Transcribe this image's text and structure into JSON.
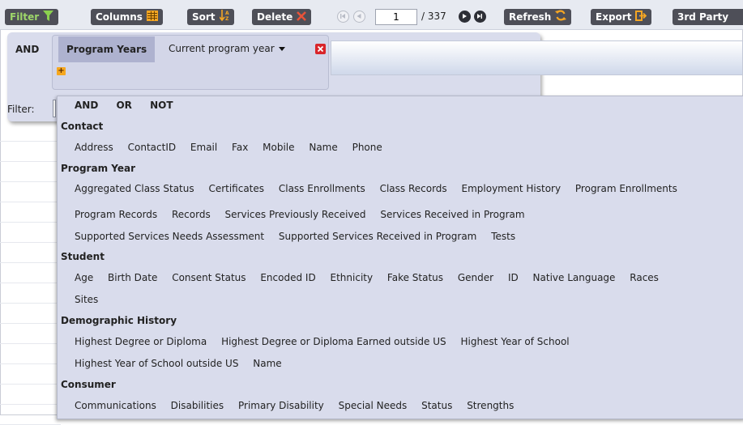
{
  "toolbar": {
    "filter_label": "Filter",
    "columns_label": "Columns",
    "sort_label": "Sort",
    "delete_label": "Delete",
    "page_value": "1",
    "page_total": "/ 337",
    "refresh_label": "Refresh",
    "export_label": "Export",
    "third_party_label": "3rd Party"
  },
  "filter_panel": {
    "root_operator": "AND",
    "condition_field": "Program Years",
    "condition_value": "Current program year",
    "add_symbol": "+",
    "filter_row_label": "Filter:"
  },
  "dropdown": {
    "operators": [
      "AND",
      "OR",
      "NOT"
    ],
    "categories": [
      {
        "name": "Contact",
        "rows": [
          [
            "Address",
            "ContactID",
            "Email",
            "Fax",
            "Mobile",
            "Name",
            "Phone"
          ]
        ]
      },
      {
        "name": "Program Year",
        "rows": [
          [
            "Aggregated Class Status",
            "Certificates",
            "Class Enrollments",
            "Class Records",
            "Employment History",
            "Program Enrollments"
          ],
          [
            "Program Records",
            "Records",
            "Services Previously Received",
            "Services Received in Program"
          ],
          [
            "Supported Services Needs Assessment",
            "Supported Services Received in Program",
            "Tests"
          ]
        ]
      },
      {
        "name": "Student",
        "rows": [
          [
            "Age",
            "Birth Date",
            "Consent Status",
            "Encoded ID",
            "Ethnicity",
            "Fake Status",
            "Gender",
            "ID",
            "Native Language",
            "Races"
          ],
          [
            "Sites"
          ]
        ]
      },
      {
        "name": "Demographic History",
        "rows": [
          [
            "Highest Degree or Diploma",
            "Highest Degree or Diploma Earned outside US",
            "Highest Year of School"
          ],
          [
            "Highest Year of School outside US",
            "Name"
          ]
        ]
      },
      {
        "name": "Consumer",
        "rows": [
          [
            "Communications",
            "Disabilities",
            "Primary Disability",
            "Special Needs",
            "Status",
            "Strengths"
          ]
        ]
      }
    ]
  },
  "colors": {
    "toolbar_button": "#4e4f58",
    "filter_green": "#9ed66a",
    "delete_red": "#e8533a",
    "panel_bg": "#d9dcec",
    "field_chip": "#aeb2cf",
    "add_orange": "#f6a71e"
  }
}
